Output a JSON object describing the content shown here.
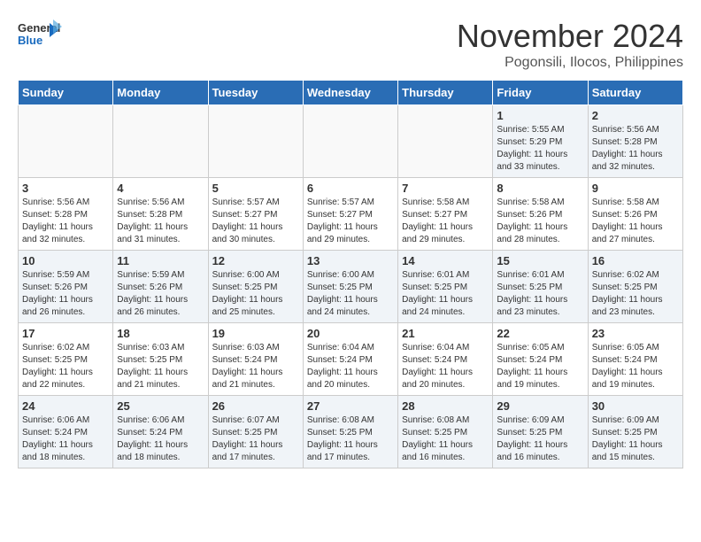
{
  "logo": {
    "line1": "General",
    "line2": "Blue"
  },
  "title": "November 2024",
  "subtitle": "Pogonsili, Ilocos, Philippines",
  "days_of_week": [
    "Sunday",
    "Monday",
    "Tuesday",
    "Wednesday",
    "Thursday",
    "Friday",
    "Saturday"
  ],
  "weeks": [
    [
      {
        "day": "",
        "info": ""
      },
      {
        "day": "",
        "info": ""
      },
      {
        "day": "",
        "info": ""
      },
      {
        "day": "",
        "info": ""
      },
      {
        "day": "",
        "info": ""
      },
      {
        "day": "1",
        "info": "Sunrise: 5:55 AM\nSunset: 5:29 PM\nDaylight: 11 hours and 33 minutes."
      },
      {
        "day": "2",
        "info": "Sunrise: 5:56 AM\nSunset: 5:28 PM\nDaylight: 11 hours and 32 minutes."
      }
    ],
    [
      {
        "day": "3",
        "info": "Sunrise: 5:56 AM\nSunset: 5:28 PM\nDaylight: 11 hours and 32 minutes."
      },
      {
        "day": "4",
        "info": "Sunrise: 5:56 AM\nSunset: 5:28 PM\nDaylight: 11 hours and 31 minutes."
      },
      {
        "day": "5",
        "info": "Sunrise: 5:57 AM\nSunset: 5:27 PM\nDaylight: 11 hours and 30 minutes."
      },
      {
        "day": "6",
        "info": "Sunrise: 5:57 AM\nSunset: 5:27 PM\nDaylight: 11 hours and 29 minutes."
      },
      {
        "day": "7",
        "info": "Sunrise: 5:58 AM\nSunset: 5:27 PM\nDaylight: 11 hours and 29 minutes."
      },
      {
        "day": "8",
        "info": "Sunrise: 5:58 AM\nSunset: 5:26 PM\nDaylight: 11 hours and 28 minutes."
      },
      {
        "day": "9",
        "info": "Sunrise: 5:58 AM\nSunset: 5:26 PM\nDaylight: 11 hours and 27 minutes."
      }
    ],
    [
      {
        "day": "10",
        "info": "Sunrise: 5:59 AM\nSunset: 5:26 PM\nDaylight: 11 hours and 26 minutes."
      },
      {
        "day": "11",
        "info": "Sunrise: 5:59 AM\nSunset: 5:26 PM\nDaylight: 11 hours and 26 minutes."
      },
      {
        "day": "12",
        "info": "Sunrise: 6:00 AM\nSunset: 5:25 PM\nDaylight: 11 hours and 25 minutes."
      },
      {
        "day": "13",
        "info": "Sunrise: 6:00 AM\nSunset: 5:25 PM\nDaylight: 11 hours and 24 minutes."
      },
      {
        "day": "14",
        "info": "Sunrise: 6:01 AM\nSunset: 5:25 PM\nDaylight: 11 hours and 24 minutes."
      },
      {
        "day": "15",
        "info": "Sunrise: 6:01 AM\nSunset: 5:25 PM\nDaylight: 11 hours and 23 minutes."
      },
      {
        "day": "16",
        "info": "Sunrise: 6:02 AM\nSunset: 5:25 PM\nDaylight: 11 hours and 23 minutes."
      }
    ],
    [
      {
        "day": "17",
        "info": "Sunrise: 6:02 AM\nSunset: 5:25 PM\nDaylight: 11 hours and 22 minutes."
      },
      {
        "day": "18",
        "info": "Sunrise: 6:03 AM\nSunset: 5:25 PM\nDaylight: 11 hours and 21 minutes."
      },
      {
        "day": "19",
        "info": "Sunrise: 6:03 AM\nSunset: 5:24 PM\nDaylight: 11 hours and 21 minutes."
      },
      {
        "day": "20",
        "info": "Sunrise: 6:04 AM\nSunset: 5:24 PM\nDaylight: 11 hours and 20 minutes."
      },
      {
        "day": "21",
        "info": "Sunrise: 6:04 AM\nSunset: 5:24 PM\nDaylight: 11 hours and 20 minutes."
      },
      {
        "day": "22",
        "info": "Sunrise: 6:05 AM\nSunset: 5:24 PM\nDaylight: 11 hours and 19 minutes."
      },
      {
        "day": "23",
        "info": "Sunrise: 6:05 AM\nSunset: 5:24 PM\nDaylight: 11 hours and 19 minutes."
      }
    ],
    [
      {
        "day": "24",
        "info": "Sunrise: 6:06 AM\nSunset: 5:24 PM\nDaylight: 11 hours and 18 minutes."
      },
      {
        "day": "25",
        "info": "Sunrise: 6:06 AM\nSunset: 5:24 PM\nDaylight: 11 hours and 18 minutes."
      },
      {
        "day": "26",
        "info": "Sunrise: 6:07 AM\nSunset: 5:25 PM\nDaylight: 11 hours and 17 minutes."
      },
      {
        "day": "27",
        "info": "Sunrise: 6:08 AM\nSunset: 5:25 PM\nDaylight: 11 hours and 17 minutes."
      },
      {
        "day": "28",
        "info": "Sunrise: 6:08 AM\nSunset: 5:25 PM\nDaylight: 11 hours and 16 minutes."
      },
      {
        "day": "29",
        "info": "Sunrise: 6:09 AM\nSunset: 5:25 PM\nDaylight: 11 hours and 16 minutes."
      },
      {
        "day": "30",
        "info": "Sunrise: 6:09 AM\nSunset: 5:25 PM\nDaylight: 11 hours and 15 minutes."
      }
    ]
  ]
}
